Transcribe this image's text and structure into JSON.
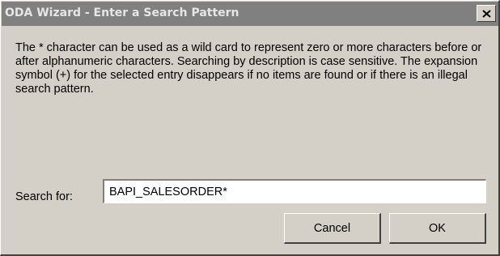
{
  "window": {
    "title": "ODA Wizard - Enter a Search Pattern",
    "close_icon": "close-icon"
  },
  "message": "The * character can be used as a wild card to represent zero or more characters before or after alphanumeric characters. Searching by description is case sensitive. The expansion symbol (+) for the selected entry disappears if no items are found or if there is an illegal search pattern.",
  "search": {
    "label": "Search for:",
    "value": "BAPI_SALESORDER*"
  },
  "buttons": {
    "cancel_label": "Cancel",
    "ok_label": "OK"
  },
  "colors": {
    "dialog_background": "#d4d0c8",
    "titlebar_inactive": "#808080",
    "title_text": "#e6e6e6"
  }
}
